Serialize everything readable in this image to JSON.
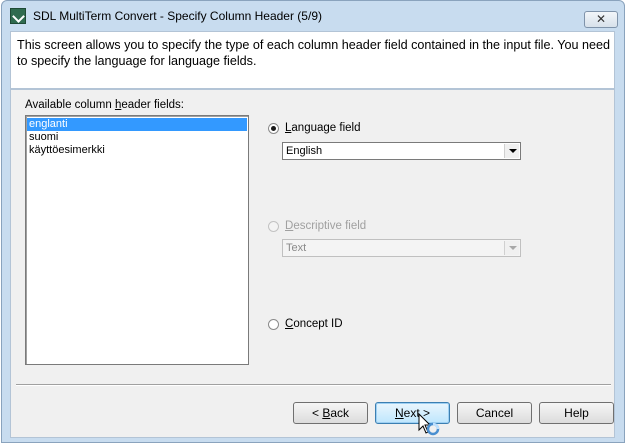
{
  "window": {
    "title": "SDL MultiTerm Convert - Specify Column Header (5/9)",
    "close_label": "✕"
  },
  "header": {
    "description": "This screen allows you to specify the type of each column header field contained in the input file. You need to specify the language for language fields."
  },
  "fields": {
    "label_pre": "Available column ",
    "label_access": "h",
    "label_post": "eader fields:",
    "items": [
      {
        "label": "englanti",
        "selected": true
      },
      {
        "label": "suomi",
        "selected": false
      },
      {
        "label": "käyttöesimerkki",
        "selected": false
      }
    ]
  },
  "options": {
    "language": {
      "access": "L",
      "rest": "anguage field",
      "checked": true,
      "enabled": true,
      "value": "English"
    },
    "descriptive": {
      "access": "D",
      "rest": "escriptive field",
      "checked": false,
      "enabled": false,
      "value": "Text"
    },
    "concept": {
      "access": "C",
      "rest": "oncept ID",
      "checked": false,
      "enabled": true
    }
  },
  "buttons": {
    "back": {
      "pre": "< ",
      "access": "B",
      "post": "ack"
    },
    "next": {
      "pre": "",
      "access": "N",
      "post": "ext >"
    },
    "cancel": "Cancel",
    "help": "Help"
  }
}
